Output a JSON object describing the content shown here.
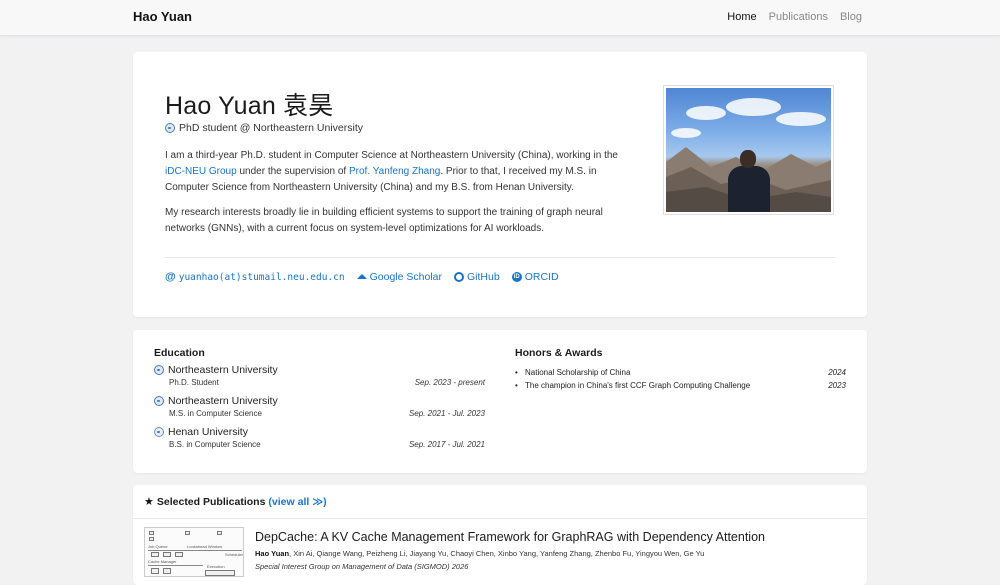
{
  "navbar": {
    "brand": "Hao Yuan",
    "links": [
      {
        "label": "Home",
        "active": true
      },
      {
        "label": "Publications",
        "active": false
      },
      {
        "label": "Blog",
        "active": false
      }
    ]
  },
  "profile": {
    "name": "Hao Yuan 袁昊",
    "role": "PhD student @ Northeastern University",
    "bio1_a": "I am a third-year Ph.D. student in Computer Science at Northeastern University (China), working in the ",
    "group_link": "iDC-NEU Group",
    "bio1_b": " under the supervision of ",
    "advisor_link": "Prof. Yanfeng Zhang",
    "bio1_c": ". Prior to that, I received my M.S. in Computer Science from Northeastern University (China) and my B.S. from Henan University.",
    "bio2": "My research interests broadly lie in building efficient systems to support the training of graph neural networks (GNNs), with a current focus on system-level optimizations for AI workloads.",
    "links": {
      "email": "yuanhao(at)stumail.neu.edu.cn",
      "scholar": "Google Scholar",
      "github": "GitHub",
      "orcid": "ORCID"
    }
  },
  "education": {
    "title": "Education",
    "items": [
      {
        "school": "Northeastern University",
        "degree": "Ph.D. Student",
        "date": "Sep. 2023 - present"
      },
      {
        "school": "Northeastern University",
        "degree": "M.S. in Computer Science",
        "date": "Sep. 2021 - Jul. 2023"
      },
      {
        "school": "Henan University",
        "degree": "B.S. in Computer Science",
        "date": "Sep. 2017 - Jul. 2021"
      }
    ]
  },
  "honors": {
    "title": "Honors & Awards",
    "items": [
      {
        "text": "National Scholarship of China",
        "year": "2024"
      },
      {
        "text": "The champion in China's first CCF Graph Computing Challenge",
        "year": "2023"
      }
    ]
  },
  "publications": {
    "title": "Selected Publications",
    "view_all": "(view all ≫)",
    "items": [
      {
        "title": "DepCache: A KV Cache Management Framework for GraphRAG with Dependency Attention",
        "first_author": "Hao Yuan",
        "other_authors": ", Xin Ai, Qiange Wang, Peizheng Li, Jiayang Yu, Chaoyi Chen, Xinbo Yang, Yanfeng Zhang, Zhenbo Fu, Yingyou Wen, Ge Yu",
        "venue": "Special Interest Group on Management of Data (SIGMOD) 2026"
      }
    ]
  },
  "thumb": {
    "labels": [
      "Job Queue",
      "Cache Manager",
      "Execution",
      "Lookahead Window",
      "Scheduler"
    ]
  }
}
